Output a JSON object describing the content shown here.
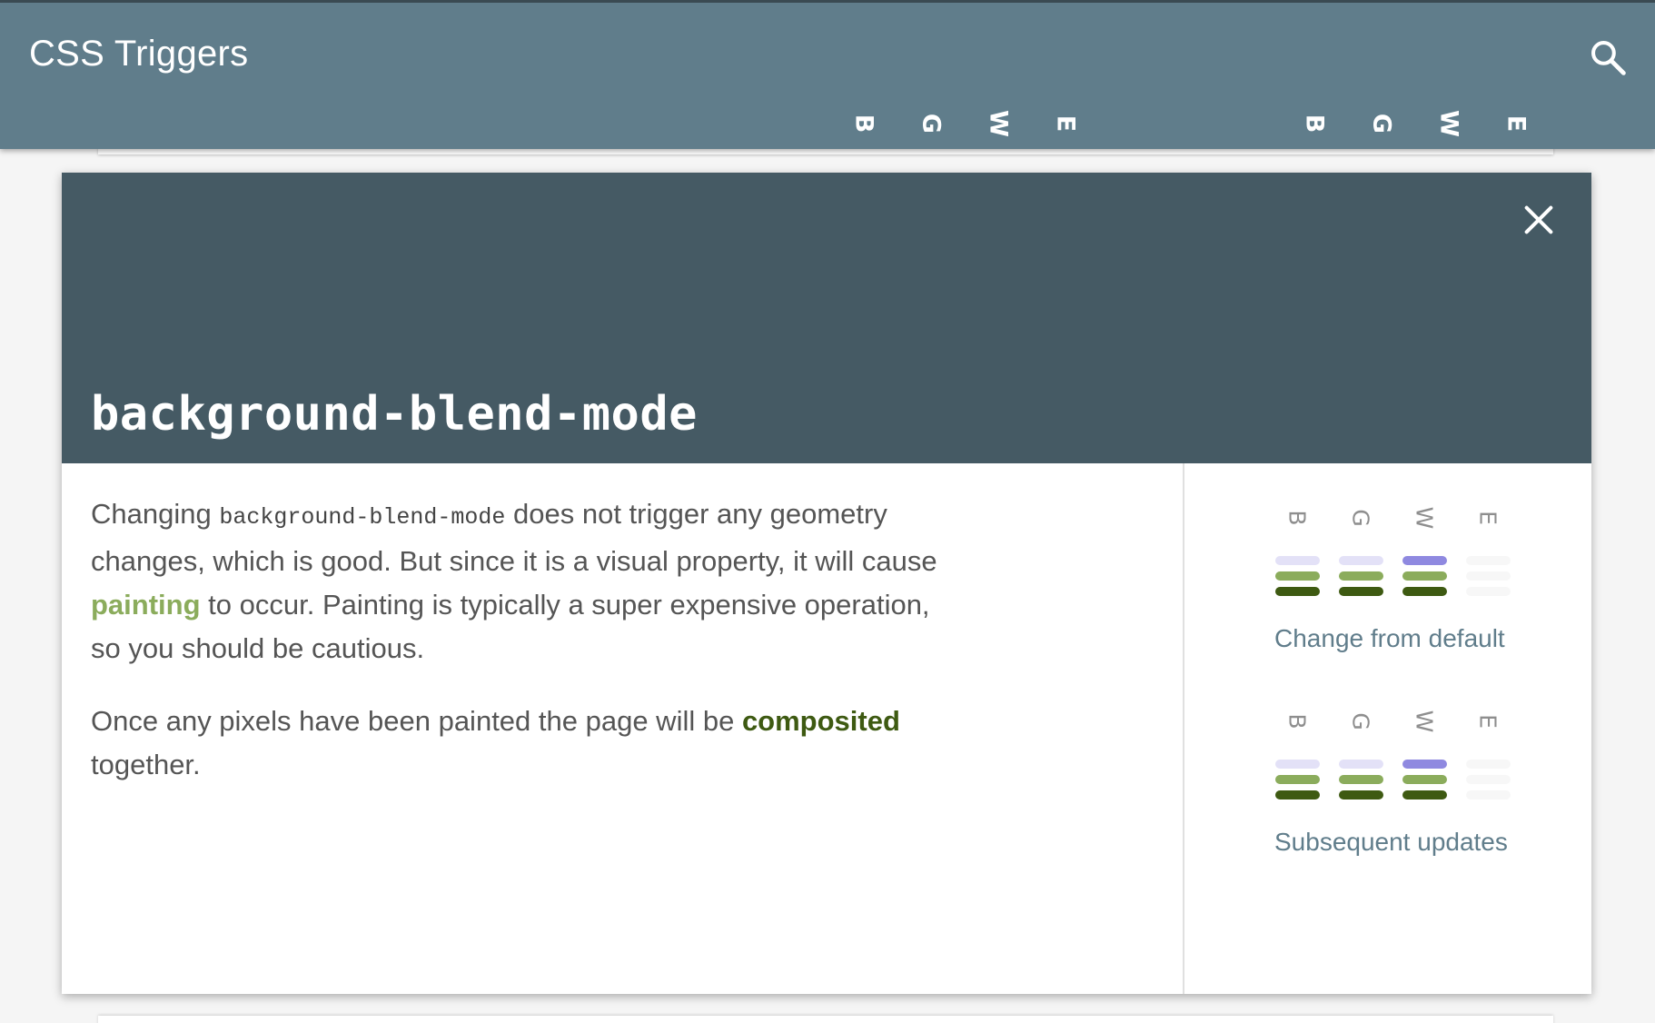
{
  "app": {
    "title": "CSS Triggers"
  },
  "header": {
    "groups": [
      {
        "letters": [
          "B",
          "G",
          "W",
          "E"
        ]
      },
      {
        "letters": [
          "B",
          "G",
          "W",
          "E"
        ]
      }
    ]
  },
  "modal": {
    "property": "background-blend-mode",
    "description": {
      "p1_before": "Changing ",
      "p1_code": "background-blend-mode",
      "p1_mid": " does not trigger any geometry changes, which is good. But since it is a visual property, it will cause ",
      "p1_link": "painting",
      "p1_after": " to occur. Painting is typically a super expensive operation, so you should be cautious.",
      "p2_before": "Once any pixels have been painted the page will be ",
      "p2_link": "composited",
      "p2_after": " together."
    },
    "sections": [
      {
        "label": "Change from default",
        "letters": [
          "B",
          "G",
          "W",
          "E"
        ]
      },
      {
        "label": "Subsequent updates",
        "letters": [
          "B",
          "G",
          "W",
          "E"
        ]
      }
    ]
  },
  "colors": {
    "topbar": "#607d8b",
    "modal_header": "#455a64",
    "layout_active": "#8f89e0",
    "layout_inactive": "#e3e1f7",
    "paint": "#8bac5c",
    "composite": "#3e5a12",
    "empty": "#f7f7f7"
  }
}
